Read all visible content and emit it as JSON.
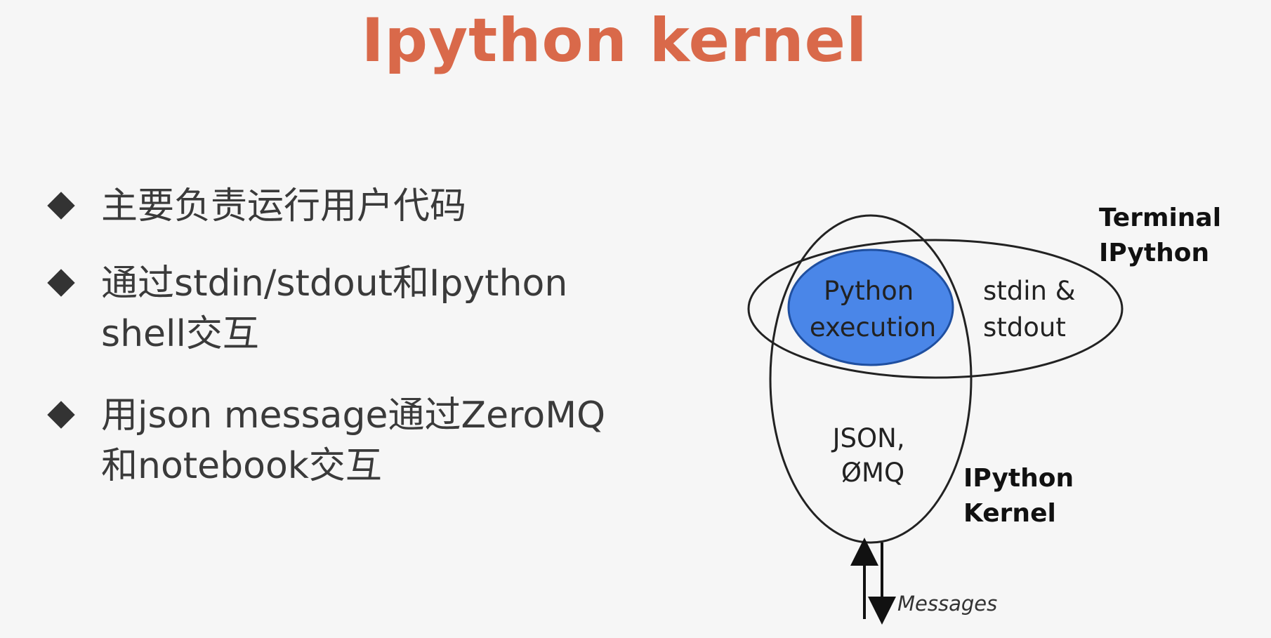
{
  "title": "Ipython kernel",
  "bullets": [
    {
      "text": "主要负责运行用户代码"
    },
    {
      "text": "通过stdin/stdout和Ipython\nshell交互"
    },
    {
      "text": "用json message通过ZeroMQ\n和notebook交互"
    }
  ],
  "diagram": {
    "python_execution": [
      "Python",
      "execution"
    ],
    "stdin_stdout": [
      "stdin &",
      "stdout"
    ],
    "json_zmq": [
      "JSON,",
      "ØMQ"
    ],
    "terminal_ipython": [
      "Terminal",
      "IPython"
    ],
    "ipython_kernel": [
      "IPython",
      "Kernel"
    ],
    "messages": "Messages"
  },
  "colors": {
    "title": "#d9694a",
    "python_execution_fill": "#4a86e8"
  }
}
